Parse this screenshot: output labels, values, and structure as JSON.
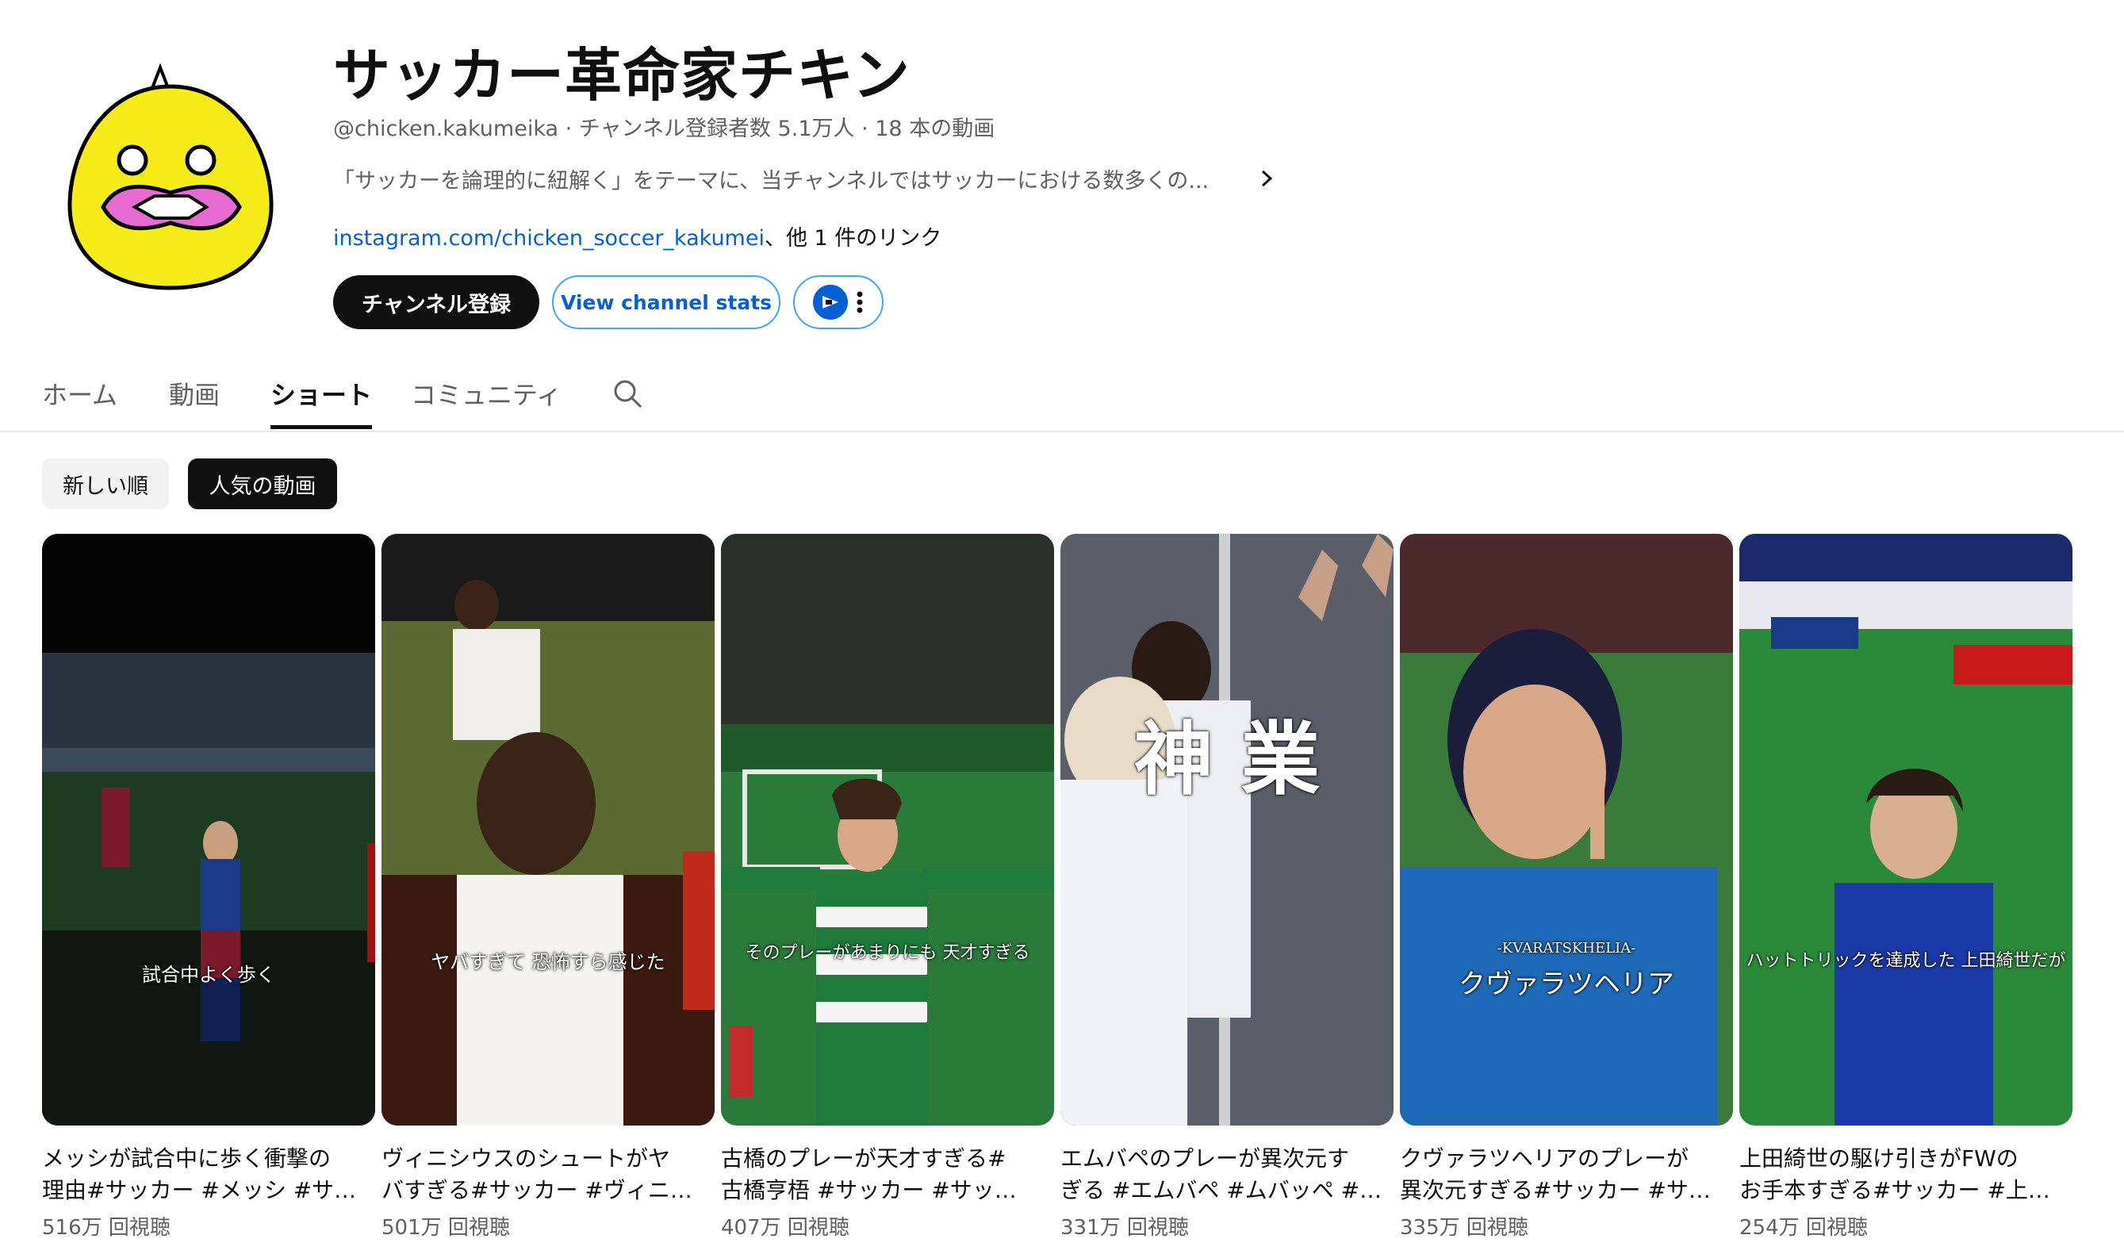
{
  "channel": {
    "name": "サッカー革命家チキン",
    "handle": "@chicken.kakumeika",
    "subscribers": "チャンネル登録者数 5.1万人",
    "video_count": "18 本の動画",
    "separator": " · ",
    "description": "「サッカーを論理的に紐解く」をテーマに、当チャンネルではサッカーにおける数多くの...",
    "link": "instagram.com/chicken_soccer_kakumei",
    "link_suffix": "、他 1 件のリンク",
    "subscribe_label": "チャンネル登録",
    "stats_label": "View channel stats"
  },
  "tabs": [
    {
      "label": "ホーム"
    },
    {
      "label": "動画"
    },
    {
      "label": "ショート",
      "active": true
    },
    {
      "label": "コミュニティ"
    }
  ],
  "chips": [
    {
      "label": "新しい順",
      "selected": false
    },
    {
      "label": "人気の動画",
      "selected": true
    }
  ],
  "videos": [
    {
      "title_line1": "メッシが試合中に歩く衝撃の",
      "title_line2": "理由#サッカー #メッシ #サ…",
      "views": "516万 回視聴",
      "caption": "試合中よく歩く"
    },
    {
      "title_line1": "ヴィニシウスのシュートがヤ",
      "title_line2": "バすぎる#サッカー #ヴィニ…",
      "views": "501万 回視聴",
      "caption": "ヤバすぎて 恐怖すら感じた"
    },
    {
      "title_line1": "古橋のプレーが天才すぎる#",
      "title_line2": "古橋亨梧 #サッカー #サッ…",
      "views": "407万 回視聴",
      "caption": "そのプレーがあまりにも 天才すぎる"
    },
    {
      "title_line1": "エムバペのプレーが異次元す",
      "title_line2": "ぎる #エムバペ #ムバッペ #…",
      "views": "331万 回視聴",
      "caption": "神 業"
    },
    {
      "title_line1": "クヴァラツヘリアのプレーが",
      "title_line2": "異次元すぎる#サッカー #サ…",
      "views": "335万 回視聴",
      "caption": "クヴァラツヘリア",
      "caption_small": "-KVARATSKHELIA-"
    },
    {
      "title_line1": "上田綺世の駆け引きがFWの",
      "title_line2": "お手本すぎる#サッカー #上…",
      "views": "254万 回視聴",
      "caption": "ハットトリックを達成した 上田綺世だが"
    }
  ],
  "colors": {
    "accent": "#065fd4",
    "outline": "#3ea6ff",
    "text": "#0f0f0f",
    "muted": "#606060",
    "avatar_yellow": "#f5ec19",
    "avatar_pink": "#e86bd4"
  }
}
